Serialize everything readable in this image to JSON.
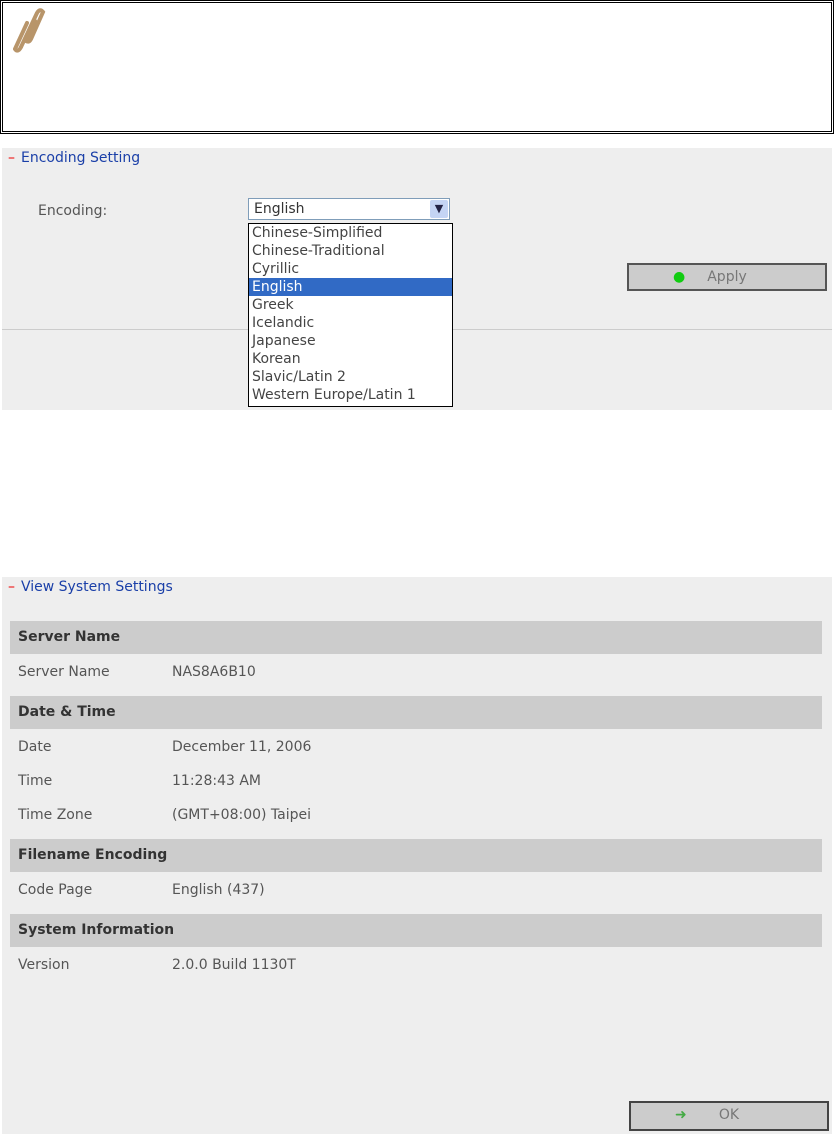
{
  "note": {
    "icon": "paperclip-icon"
  },
  "encoding": {
    "title": "Encoding Setting",
    "label": "Encoding:",
    "selected": "English",
    "options": [
      "Chinese-Simplified",
      "Chinese-Traditional",
      "Cyrillic",
      "English",
      "Greek",
      "Icelandic",
      "Japanese",
      "Korean",
      "Slavic/Latin 2",
      "Western Europe/Latin 1"
    ],
    "apply": "Apply"
  },
  "view": {
    "title": "View System Settings",
    "sections": [
      {
        "header": "Server Name",
        "rows": [
          {
            "k": "Server Name",
            "v": "NAS8A6B10"
          }
        ]
      },
      {
        "header": "Date & Time",
        "rows": [
          {
            "k": "Date",
            "v": "December 11, 2006"
          },
          {
            "k": "Time",
            "v": "11:28:43 AM"
          },
          {
            "k": "Time Zone",
            "v": "(GMT+08:00) Taipei"
          }
        ]
      },
      {
        "header": "Filename Encoding",
        "rows": [
          {
            "k": "Code Page",
            "v": "English (437)"
          }
        ]
      },
      {
        "header": "System Information",
        "rows": [
          {
            "k": "Version",
            "v": "2.0.0 Build 1130T"
          }
        ]
      }
    ],
    "ok": "OK"
  }
}
